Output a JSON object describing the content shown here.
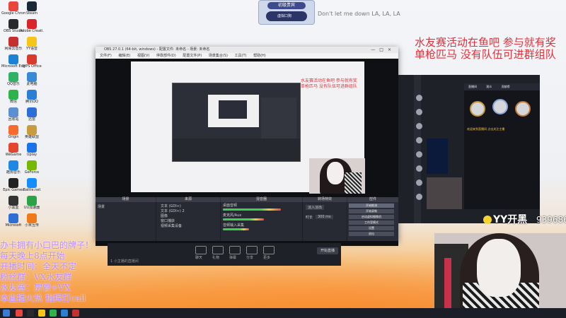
{
  "desktop_icons": [
    {
      "label": "Google Chrome",
      "color": "#e8453c"
    },
    {
      "label": "Steam",
      "color": "#1b2838"
    },
    {
      "label": "OBS Studio",
      "color": "#2a2a2a"
    },
    {
      "label": "Adobe Creati.",
      "color": "#d9252a"
    },
    {
      "label": "网易云音乐",
      "color": "#c62f2f"
    },
    {
      "label": "YY语音",
      "color": "#f5c518"
    },
    {
      "label": "Microsoft Edge",
      "color": "#1c82d4"
    },
    {
      "label": "WPS Office",
      "color": "#d83b2c"
    },
    {
      "label": "QQ音乐",
      "color": "#2fb166"
    },
    {
      "label": "此电脑",
      "color": "#3a89d6"
    },
    {
      "label": "微信",
      "color": "#2db34a"
    },
    {
      "label": "腾讯QQ",
      "color": "#2a7fd4"
    },
    {
      "label": "回收站",
      "color": "#5a8fd1"
    },
    {
      "label": "迅雷",
      "color": "#2c6ed6"
    },
    {
      "label": "Origin",
      "color": "#f56c2d"
    },
    {
      "label": "英雄联盟",
      "color": "#c89b3c"
    },
    {
      "label": "WeGame",
      "color": "#e3452f"
    },
    {
      "label": "Uplay",
      "color": "#1a73e8"
    },
    {
      "label": "酷狗音乐",
      "color": "#1e88e5"
    },
    {
      "label": "GeForce",
      "color": "#76b900"
    },
    {
      "label": "Epic Games",
      "color": "#222222"
    },
    {
      "label": "Battle.net",
      "color": "#148eff"
    },
    {
      "label": "小黑盒",
      "color": "#333333"
    },
    {
      "label": "UU加速器",
      "color": "#2ba245"
    },
    {
      "label": "Microsoft",
      "color": "#2e6fd3"
    },
    {
      "label": "小米互传",
      "color": "#f07a1a"
    }
  ],
  "obs": {
    "title": "OBS 27.0.1 (64-bit, windows) - 配置文件: 未命名 - 场景: 未命名",
    "menu": [
      "文件(F)",
      "编辑(E)",
      "视图(V)",
      "停靠部件(D)",
      "配置文件(P)",
      "场景集合(S)",
      "工具(T)",
      "帮助(H)"
    ],
    "docks": {
      "scenes": "场景",
      "sources": "来源",
      "mixer": "混音器",
      "transitions": "转场特效",
      "controls": "控件"
    },
    "scene_items": [
      "场景"
    ],
    "source_items": [
      "文本 (GDI+)",
      "文本 (GDI+) 2",
      "图像",
      "窗口捕获",
      "视频采集设备"
    ],
    "mixer_tracks": [
      {
        "name": "桌面音频",
        "level": 0.78
      },
      {
        "name": "麦克风/Aux",
        "level": 0.55
      },
      {
        "name": "音频输入采集",
        "level": 0.35
      }
    ],
    "transition": "淡入淡出",
    "duration_label": "时长",
    "duration_value": "300 ms",
    "controls": [
      "开始推流",
      "开始录制",
      "启动虚拟摄像机",
      "工作室模式",
      "设置",
      "退出"
    ]
  },
  "badge": {
    "top": "初级贵宾",
    "user": "虚拟口狗"
  },
  "song": "Don't let me down LA, LA, LA",
  "promo": {
    "line1": "水友赛活动在鱼吧 参与就有奖",
    "line2": "单枪匹马 没有队伍可进群组队"
  },
  "scroll_text": [
    "办卡拥有小口巴的牌子！",
    "每天晚上8点开始",
    "开播时间：全天不定",
    "粉丝群：VX水友群",
    "水友赛：房管+VX",
    "本直播火热 指挥打call"
  ],
  "yy": {
    "logo": "YY开黑",
    "id": "939686",
    "tabs": [
      "直播间",
      "观众",
      "贡献榜"
    ],
    "tip": "欢迎来到直播间 点击关注主播"
  },
  "subbar": {
    "items": [
      "聊天",
      "礼物",
      "弹幕",
      "分享",
      "更多"
    ],
    "live_btn": "开始直播",
    "room_hint": "1 小主播的直播间"
  }
}
